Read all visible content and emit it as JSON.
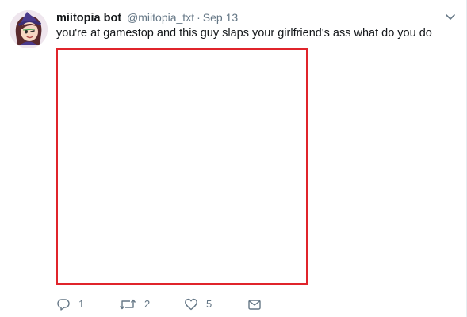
{
  "tweet": {
    "author": {
      "name": "miitopia bot",
      "handle": "@miitopia_txt"
    },
    "separator": "·",
    "timestamp": "Sep 13",
    "text": "you're at gamestop and this guy slaps your girlfriend's ass what do you do",
    "media": {
      "border_color": "#e0242b"
    },
    "actions": {
      "reply_count": "1",
      "retweet_count": "2",
      "like_count": "5"
    }
  },
  "icons": {
    "menu": "chevron-down-icon",
    "reply": "reply-icon",
    "retweet": "retweet-icon",
    "like": "heart-icon",
    "dm": "envelope-icon"
  },
  "colors": {
    "text": "#14171a",
    "secondary": "#657786"
  }
}
